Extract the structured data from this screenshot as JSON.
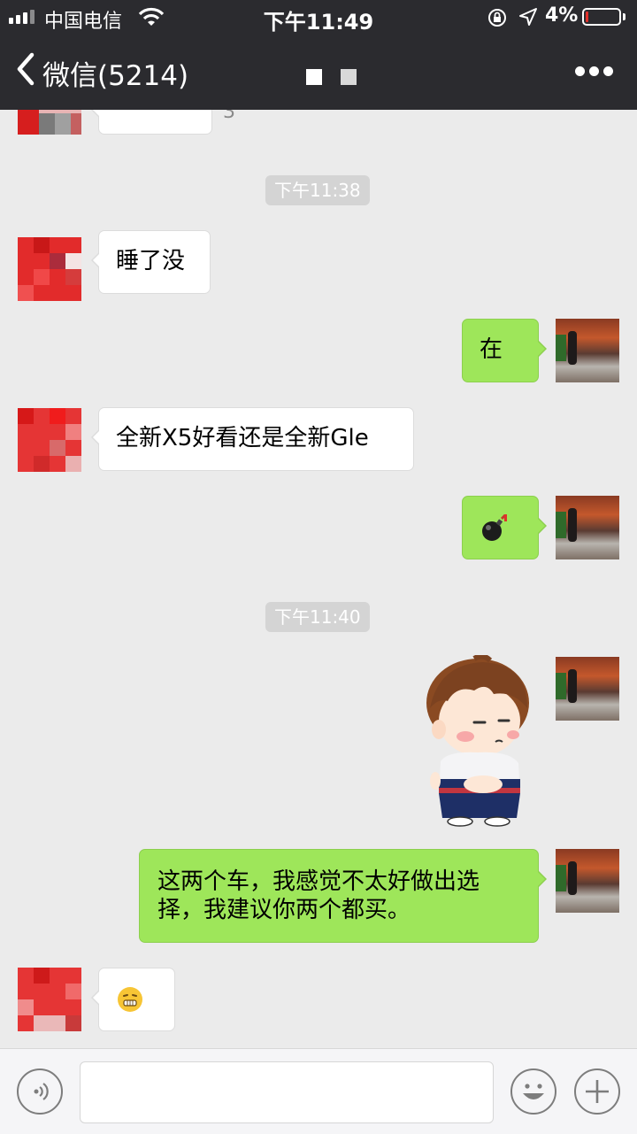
{
  "status_bar": {
    "carrier": "中国电信",
    "time": "下午11:49",
    "battery": "4%",
    "battery_level": 0.04
  },
  "nav": {
    "back_label": "微信(5214)"
  },
  "messages": {
    "prev_partial_text": "3",
    "time1": "下午11:38",
    "m1": "睡了没",
    "m2": "在",
    "m3": "全新X5好看还是全新Gle",
    "m4_icon": "bomb-emoji",
    "time2": "下午11:40",
    "m5_icon": "cartoon-boy-sticker",
    "m6_line1": "这两个车，我感觉不太好做出选",
    "m6_line2": "择，我建议你两个都买。",
    "m7_icon": "grimace-emoji"
  },
  "input_bar": {
    "voice_icon": "voice-icon",
    "emoji_icon": "emoji-icon",
    "plus_icon": "plus-icon"
  },
  "colors": {
    "header_bg": "#2b2b2f",
    "chat_bg": "#ebebeb",
    "bubble_green": "#9ee65a",
    "bubble_white": "#ffffff",
    "time_chip": "#d4d4d4"
  }
}
